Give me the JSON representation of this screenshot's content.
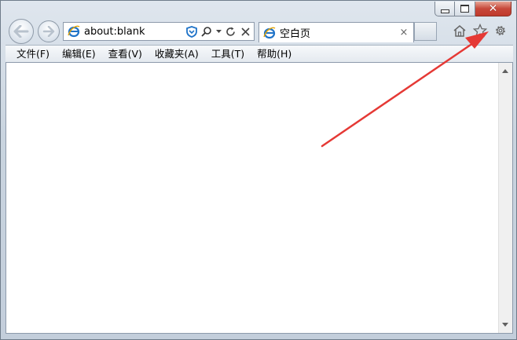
{
  "address": {
    "url": "about:blank"
  },
  "tab": {
    "title": "空白页",
    "close": "×"
  },
  "menu": {
    "items": [
      "文件(F)",
      "编辑(E)",
      "查看(V)",
      "收藏夹(A)",
      "工具(T)",
      "帮助(H)"
    ]
  },
  "window": {
    "close": "✕"
  },
  "icons": {
    "back": "back-arrow-icon",
    "forward": "forward-arrow-icon",
    "ie": "ie-logo-icon",
    "shield": "shield-icon",
    "search": "search-icon",
    "refresh": "refresh-icon",
    "stop": "close-icon",
    "home": "home-icon",
    "favorites": "star-icon",
    "tools": "gear-icon"
  },
  "colors": {
    "ie_blue": "#1f73c8",
    "annotation_arrow": "#e53935"
  }
}
